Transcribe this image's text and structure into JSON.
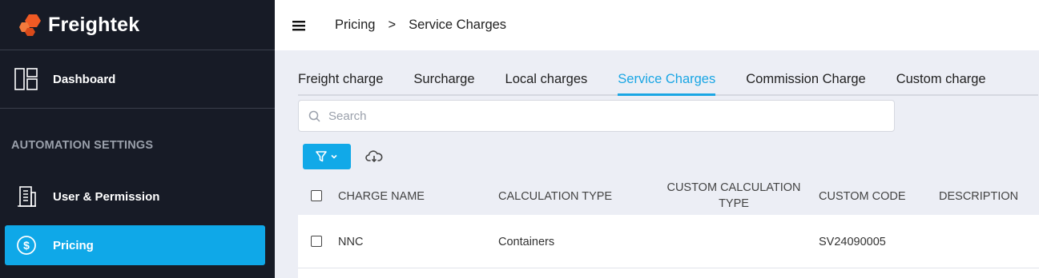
{
  "brand": {
    "name": "Freightek",
    "accent": "#f05a24"
  },
  "sidebar": {
    "dashboard_label": "Dashboard",
    "section_title": "AUTOMATION SETTINGS",
    "user_permission_label": "User & Permission",
    "pricing_label": "Pricing",
    "active_color": "#0fa8e8"
  },
  "breadcrumb": {
    "parent": "Pricing",
    "separator": ">",
    "current": "Service Charges"
  },
  "tabs": [
    {
      "label": "Freight charge"
    },
    {
      "label": "Surcharge"
    },
    {
      "label": "Local charges"
    },
    {
      "label": "Service Charges",
      "active": true
    },
    {
      "label": "Commission Charge"
    },
    {
      "label": "Custom charge"
    }
  ],
  "search": {
    "placeholder": "Search"
  },
  "table": {
    "columns": [
      "CHARGE NAME",
      "CALCULATION TYPE",
      "CUSTOM CALCULATION TYPE",
      "CUSTOM CODE",
      "DESCRIPTION"
    ],
    "rows": [
      {
        "charge_name": "NNC",
        "calculation_type": "Containers",
        "custom_calculation_type": "",
        "custom_code": "SV24090005",
        "description": ""
      }
    ]
  }
}
